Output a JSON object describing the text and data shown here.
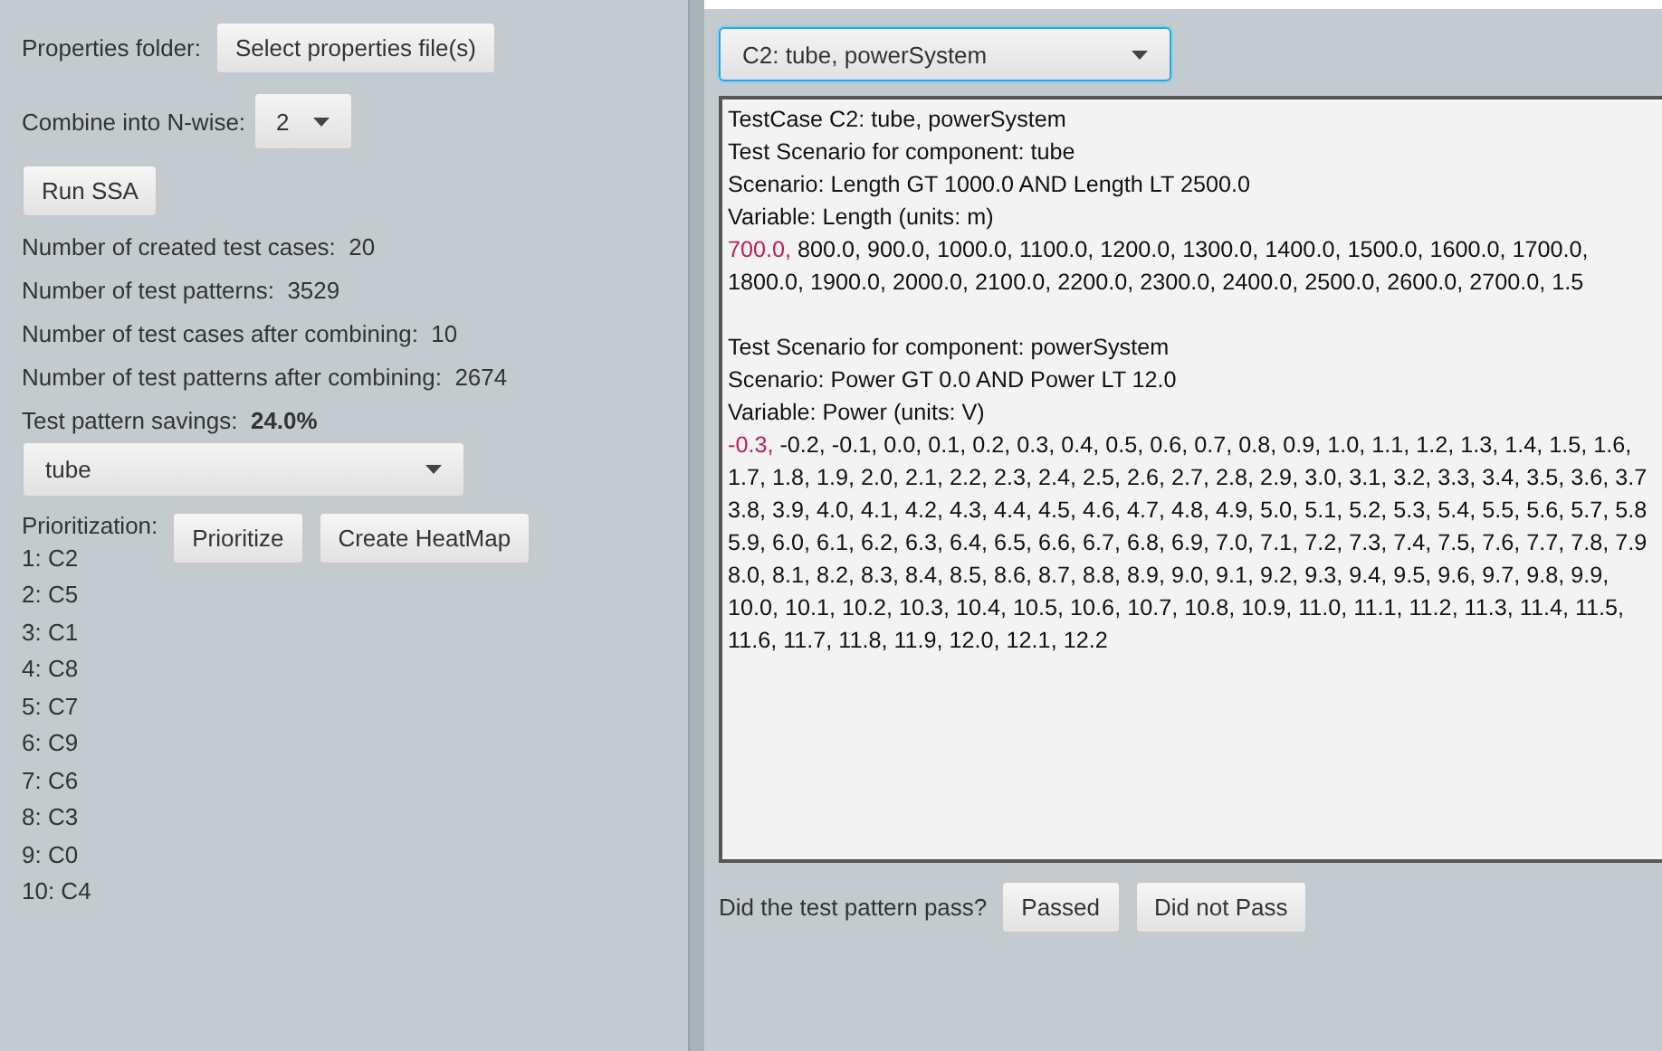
{
  "left_panel": {
    "properties_label": "Properties folder:",
    "select_button": "Select properties file(s)",
    "nwise_label": "Combine into N-wise:",
    "nwise_value": "2",
    "run_button": "Run SSA",
    "stats": [
      {
        "label": "Number of created test cases:",
        "value": "20",
        "bold": false
      },
      {
        "label": "Number of test patterns:",
        "value": "3529",
        "bold": false
      },
      {
        "label": "Number of test cases after combining:",
        "value": "10",
        "bold": false
      },
      {
        "label": "Number of test patterns after combining:",
        "value": "2674",
        "bold": false
      },
      {
        "label": "Test pattern savings:",
        "value": "24.0%",
        "bold": true
      }
    ],
    "component_select": "tube",
    "prioritization_label": "Prioritization:",
    "prioritize_button": "Prioritize",
    "heatmap_button": "Create HeatMap",
    "priority_list": [
      "1: C2",
      "2: C5",
      "3: C1",
      "4: C8",
      "5: C7",
      "6: C9",
      "7: C6",
      "8: C3",
      "9: C0",
      "10: C4"
    ]
  },
  "right_panel": {
    "test_case_select": "C2: tube, powerSystem",
    "details": [
      {
        "kind": "text",
        "text": "TestCase C2: tube, powerSystem"
      },
      {
        "kind": "text",
        "text": "Test Scenario for component: tube"
      },
      {
        "kind": "text",
        "text": "Scenario: Length GT 1000.0 AND Length LT 2500.0"
      },
      {
        "kind": "text",
        "text": "Variable: Length (units: m)"
      },
      {
        "kind": "values",
        "highlight": "700.0,",
        "text": "800.0, 900.0, 1000.0, 1100.0, 1200.0, 1300.0, 1400.0, 1500.0, 1600.0, 1700.0,"
      },
      {
        "kind": "text",
        "text": "1800.0, 1900.0, 2000.0, 2100.0, 2200.0, 2300.0, 2400.0, 2500.0, 2600.0, 2700.0, 1.5"
      },
      {
        "kind": "blank"
      },
      {
        "kind": "text",
        "text": "Test Scenario for component: powerSystem"
      },
      {
        "kind": "text",
        "text": "Scenario: Power GT 0.0 AND Power LT 12.0"
      },
      {
        "kind": "text",
        "text": "Variable: Power (units: V)"
      },
      {
        "kind": "values",
        "highlight": "-0.3,",
        "text": "-0.2, -0.1, 0.0, 0.1, 0.2, 0.3, 0.4, 0.5, 0.6, 0.7, 0.8, 0.9, 1.0, 1.1, 1.2, 1.3, 1.4, 1.5, 1.6,"
      },
      {
        "kind": "text",
        "text": "1.7, 1.8, 1.9, 2.0, 2.1, 2.2, 2.3, 2.4, 2.5, 2.6, 2.7, 2.8, 2.9, 3.0, 3.1, 3.2, 3.3, 3.4, 3.5, 3.6, 3.7"
      },
      {
        "kind": "text",
        "text": "3.8, 3.9, 4.0, 4.1, 4.2, 4.3, 4.4, 4.5, 4.6, 4.7, 4.8, 4.9, 5.0, 5.1, 5.2, 5.3, 5.4, 5.5, 5.6, 5.7, 5.8"
      },
      {
        "kind": "text",
        "text": "5.9, 6.0, 6.1, 6.2, 6.3, 6.4, 6.5, 6.6, 6.7, 6.8, 6.9, 7.0, 7.1, 7.2, 7.3, 7.4, 7.5, 7.6, 7.7, 7.8, 7.9"
      },
      {
        "kind": "text",
        "text": "8.0, 8.1, 8.2, 8.3, 8.4, 8.5, 8.6, 8.7, 8.8, 8.9, 9.0, 9.1, 9.2, 9.3, 9.4, 9.5, 9.6, 9.7, 9.8, 9.9,"
      },
      {
        "kind": "text",
        "text": "10.0, 10.1, 10.2, 10.3, 10.4, 10.5, 10.6, 10.7, 10.8, 10.9, 11.0, 11.1, 11.2, 11.3, 11.4, 11.5,"
      },
      {
        "kind": "text",
        "text": "11.6, 11.7, 11.8, 11.9, 12.0, 12.1, 12.2"
      }
    ],
    "pass_question": "Did the test pattern pass?",
    "passed_button": "Passed",
    "failed_button": "Did not Pass"
  }
}
